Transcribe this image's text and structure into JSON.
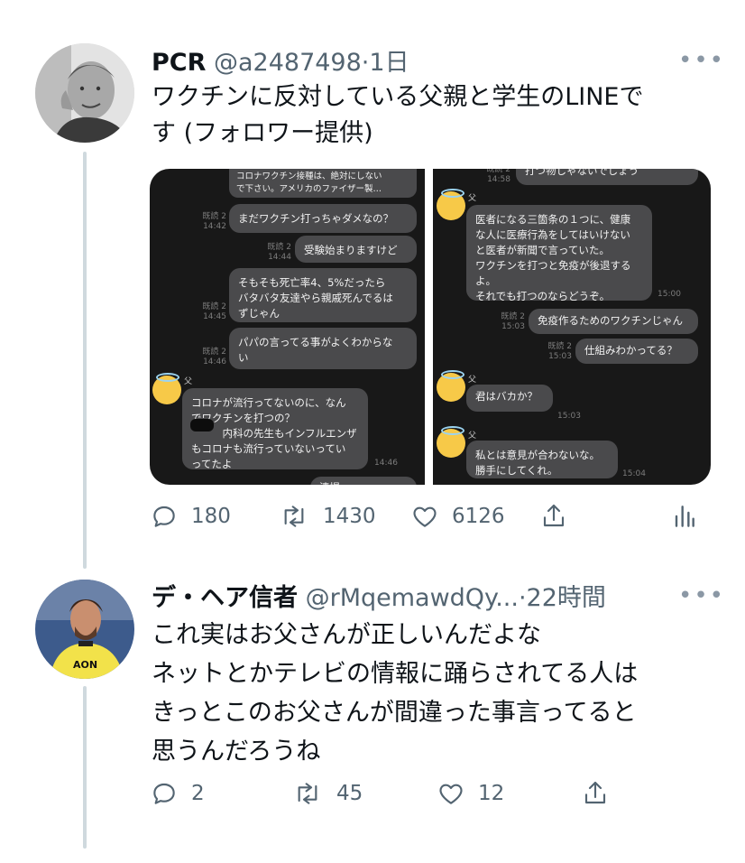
{
  "tweet1": {
    "name": "PCR",
    "handle": "@a2487498",
    "sep": "·",
    "time": "1日",
    "more": "•••",
    "text_line1": "ワクチンに反対している父親と学生のLINEで",
    "text_line2": "す (フォロワー提供)",
    "counts": {
      "reply": "180",
      "retweet": "1430",
      "like": "6126"
    },
    "left_chat": {
      "truncated_bubble": "コロナワクチン接種は、絶対にしない\nで下さい。アメリカのファイザー製…",
      "messages": [
        {
          "read": "既読 2\n14:42",
          "text": "まだワクチン打っちゃダメなの？"
        },
        {
          "read": "既読 2\n14:44",
          "text": "受験始まりますけど"
        },
        {
          "read": "既読 2\n14:45",
          "text": "そもそも死亡率4、5%だったら\nバタバタ友達やら親戚死んでるは\nずじゃん"
        },
        {
          "read": "既読 2\n14:46",
          "text": "パパの言ってる事がよくわからな\nい"
        }
      ],
      "father_label": "父",
      "father_message": "コロナが流行ってないのに、なん\nでワクチンを打つの？\n　　　内科の先生もインフルエンザ\nもコロナも流行っていないってい\nってたよ",
      "father_time": "14:46",
      "bottom_cut": "清提　　　　"
    },
    "right_chat": {
      "top_cut": "打つ物しゃないでしょう",
      "top_read": "既読 2\n14:58",
      "father_label": "父",
      "msg1": "医者になる三箇条の１つに、健康\nな人に医療行為をしてはいけない\nと医者が新聞で言っていた。\nワクチンを打つと免疫が後退する\nよ。\nそれでも打つのならどうぞ。",
      "msg1_time": "15:00",
      "sent1_read": "既読 2\n15:03",
      "sent1": "免疫作るためのワクチンじゃん",
      "sent2_read": "既読 2\n15:03",
      "sent2": "仕組みわかってる？",
      "msg2": "君はバカか？",
      "msg2_time": "15:03",
      "msg3": "私とは意見が合わないな。\n勝手にしてくれ。",
      "msg3_time": "15:04"
    }
  },
  "tweet2": {
    "name": "デ・ヘア信者",
    "handle": "@rMqemawdQy...",
    "sep": "·",
    "time": "22時間",
    "more": "•••",
    "lines": [
      "これ実はお父さんが正しいんだよな",
      "ネットとかテレビの情報に踊らされてる人は",
      "きっとこのお父さんが間違った事言ってると",
      "思うんだろうね"
    ],
    "counts": {
      "reply": "2",
      "retweet": "45",
      "like": "12"
    }
  },
  "colors": {
    "text": "#0f1419",
    "secondary": "#536471",
    "thread": "#cfd9de",
    "chat_bg": "#181818",
    "bubble": "#4a4a4c"
  }
}
